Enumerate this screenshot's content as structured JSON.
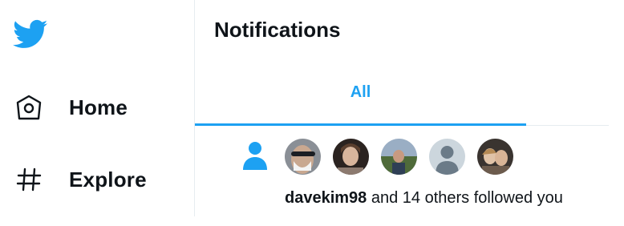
{
  "sidebar": {
    "logo": "twitter-bird-icon",
    "items": [
      {
        "label": "Home",
        "icon": "home-icon"
      },
      {
        "label": "Explore",
        "icon": "hashtag-icon"
      }
    ]
  },
  "header": {
    "title": "Notifications"
  },
  "tabs": [
    {
      "label": "All",
      "active": true
    }
  ],
  "notification": {
    "icon": "person-icon",
    "username": "davekim98",
    "message": " and 14 others followed you",
    "avatars": [
      "avatar-1",
      "avatar-2",
      "avatar-3",
      "avatar-4-default",
      "avatar-5"
    ]
  },
  "colors": {
    "accent": "#1da1f2",
    "text": "#0f1419",
    "border": "#e6ecf0"
  }
}
